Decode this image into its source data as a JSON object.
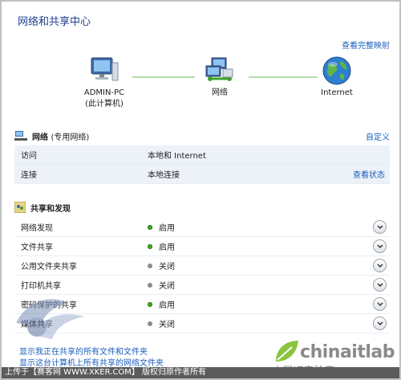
{
  "window": {
    "title": "网络和共享中心"
  },
  "map": {
    "view_full_map": "查看完整映射",
    "nodes": [
      {
        "label": "ADMIN-PC",
        "sublabel": "(此计算机)",
        "icon": "computer-icon"
      },
      {
        "label": "网络",
        "icon": "network-icon"
      },
      {
        "label": "Internet",
        "icon": "globe-icon"
      }
    ]
  },
  "network": {
    "title": "网络",
    "title_sub": "(专用网络)",
    "customize": "自定义",
    "rows": [
      {
        "label": "访问",
        "value": "本地和 Internet",
        "action": ""
      },
      {
        "label": "连接",
        "value": "本地连接",
        "action": "查看状态"
      }
    ]
  },
  "sharing": {
    "title": "共享和发现",
    "items": [
      {
        "label": "网络发现",
        "status": "启用",
        "on": true
      },
      {
        "label": "文件共享",
        "status": "启用",
        "on": true
      },
      {
        "label": "公用文件夹共享",
        "status": "关闭",
        "on": false
      },
      {
        "label": "打印机共享",
        "status": "关闭",
        "on": false
      },
      {
        "label": "密码保护的共享",
        "status": "启用",
        "on": true
      },
      {
        "label": "媒体共享",
        "status": "关闭",
        "on": false
      }
    ]
  },
  "footer": {
    "link1": "显示我正在共享的所有文件和文件夹",
    "link2": "显示这台计算机上所有共享的网络文件夹"
  },
  "watermark": {
    "brand": "chinaitlab",
    "tagline": "中国IT实验室",
    "credit": "上传于【赛客网 WWW.XKER.COM】 版权归原作者所有"
  },
  "colors": {
    "title": "#1e3f8f",
    "link": "#1a5ebd",
    "enabled": "#43a61c",
    "disabled": "#8a8a8a"
  }
}
